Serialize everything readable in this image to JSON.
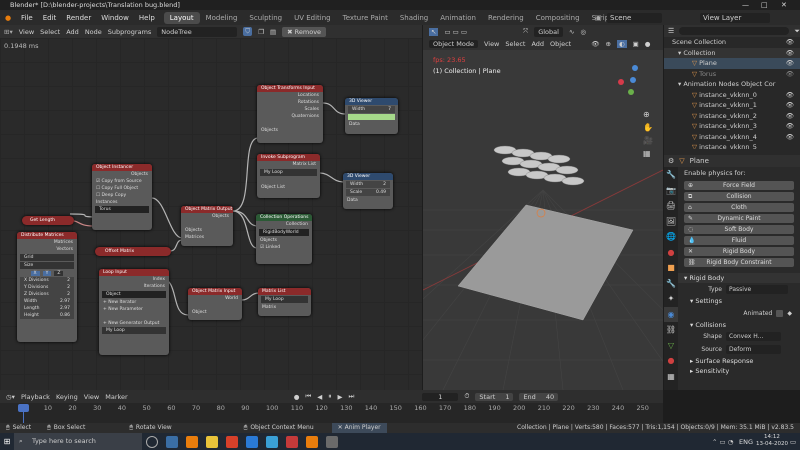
{
  "title": "Blender* [D:\\blender-projects\\Translation bug.blend]",
  "window_controls": [
    "—",
    "□",
    "✕"
  ],
  "menu": [
    "File",
    "Edit",
    "Render",
    "Window",
    "Help"
  ],
  "workspaces": [
    "Layout",
    "Modeling",
    "Sculpting",
    "UV Editing",
    "Texture Paint",
    "Shading",
    "Animation",
    "Rendering",
    "Compositing",
    "Scripting"
  ],
  "scene": "Scene",
  "view_layer": "View Layer",
  "node_editor": {
    "menus": [
      "View",
      "Select",
      "Add",
      "Node",
      "Subprograms"
    ],
    "tree": "NodeTree",
    "remove": "Remove",
    "time": "0.1948 ms"
  },
  "nodes": {
    "object_instancer": {
      "title": "Object Instancer",
      "out": "Objects",
      "opt1": "Copy from Source",
      "opt2": "Copy Full Object",
      "opt3": "Deep Copy",
      "in": "Instances",
      "obj": "Torus"
    },
    "get_length": "Get Length",
    "distribute": {
      "title": "Distribute Matrices",
      "out1": "Matrices",
      "out2": "Vectors",
      "mode1": "Grid",
      "mode2": "Size",
      "x": "X",
      "y": "Y",
      "z": "Z",
      "xd_l": "X Divisions",
      "xd_v": "2",
      "yd_l": "Y Divisions",
      "yd_v": "2",
      "zd_l": "Z Divisions",
      "zd_v": "2",
      "w_l": "Width",
      "w_v": "2.97",
      "len_l": "Length",
      "len_v": "2.97",
      "h_l": "Height",
      "h_v": "0.86"
    },
    "offset_matrix": "Offset Matrix",
    "loop_input": {
      "title": "Loop Input",
      "o1": "Index",
      "o2": "Iterations",
      "o3": "Object",
      "a1": "New Iterator",
      "a2": "New Parameter",
      "a3": "New Generator Output",
      "loop": "My Loop"
    },
    "obj_matrix_output": {
      "title": "Object Matrix Output",
      "o1": "Objects",
      "i1": "Objects",
      "i2": "Matrices"
    },
    "obj_matrix_input": {
      "title": "Object Matrix Input",
      "o1": "World",
      "i1": "Object"
    },
    "transforms_input": {
      "title": "Object Transforms Input",
      "o1": "Locations",
      "o2": "Rotations",
      "o3": "Scales",
      "o4": "Quaternions",
      "i1": "Objects"
    },
    "viewer1": {
      "title": "3D Viewer",
      "w": "Width",
      "wv": "7",
      "d": "Data"
    },
    "invoke": {
      "title": "Invoke Subprogram",
      "o1": "Matrix List",
      "loop": "My Loop",
      "i1": "Object List"
    },
    "viewer2": {
      "title": "3D Viewer",
      "w": "Width",
      "wv": "2",
      "s": "Scale",
      "sv": "0.49",
      "d": "Data"
    },
    "collection_ops": {
      "title": "Collection Operations",
      "o1": "Collection",
      "field": "RigidBodyWorld",
      "i1": "Objects",
      "i2": "Linked"
    },
    "matrix_list": {
      "title": "Matrix List",
      "loop": "My Loop",
      "i1": "Matrix"
    }
  },
  "viewport": {
    "mode": "Object Mode",
    "menus": [
      "View",
      "Select",
      "Add",
      "Object"
    ],
    "transform": "Global",
    "fps": "fps: 23.65",
    "info": "(1) Collection | Plane"
  },
  "outliner": {
    "rows": [
      {
        "label": "Scene Collection",
        "indent": 0
      },
      {
        "label": "Collection",
        "indent": 1
      },
      {
        "label": "Plane",
        "indent": 2
      },
      {
        "label": "Torus",
        "indent": 2
      },
      {
        "label": "Animation Nodes Object Cor",
        "indent": 1
      },
      {
        "label": "instance_vkknn_0",
        "indent": 2
      },
      {
        "label": "instance_vkknn_1",
        "indent": 2
      },
      {
        "label": "instance_vkknn_2",
        "indent": 2
      },
      {
        "label": "instance_vkknn_3",
        "indent": 2
      },
      {
        "label": "instance_vkknn_4",
        "indent": 2
      },
      {
        "label": "instance_vkknn_5",
        "indent": 2
      }
    ]
  },
  "properties": {
    "object": "Plane",
    "physics_label": "Enable physics for:",
    "buttons": [
      "Force Field",
      "Collision",
      "Cloth",
      "Dynamic Paint",
      "Soft Body",
      "Fluid",
      "Rigid Body",
      "Rigid Body Constraint"
    ],
    "rigid_body": "Rigid Body",
    "type_l": "Type",
    "type_v": "Passive",
    "settings": "Settings",
    "animated": "Animated",
    "collisions": "Collisions",
    "shape_l": "Shape",
    "shape_v": "Convex H...",
    "source_l": "Source",
    "source_v": "Deform",
    "surface": "Surface Response",
    "sensitivity": "Sensitivity"
  },
  "timeline": {
    "menus": [
      "Playback",
      "Keying",
      "View",
      "Marker"
    ],
    "current": "1",
    "start_l": "Start",
    "start_v": "1",
    "end_l": "End",
    "end_v": "40",
    "ticks": [
      "1",
      "10",
      "20",
      "30",
      "40",
      "50",
      "60",
      "70",
      "80",
      "90",
      "100",
      "110",
      "120",
      "130",
      "140",
      "150",
      "160",
      "170",
      "180",
      "190",
      "200",
      "210",
      "220",
      "230",
      "240",
      "250"
    ]
  },
  "status": {
    "select": "Select",
    "box": "Box Select",
    "rotate": "Rotate View",
    "ctx": "Object Context Menu",
    "anim": "Anim Player",
    "info": "Collection | Plane | Verts:580 | Faces:577 | Tris:1,154 | Objects:0/9 | Mem: 35.1 MiB | v2.83.5"
  },
  "taskbar": {
    "search": "Type here to search",
    "lang": "ENG",
    "time": "14:12",
    "date": "13-04-2020"
  }
}
